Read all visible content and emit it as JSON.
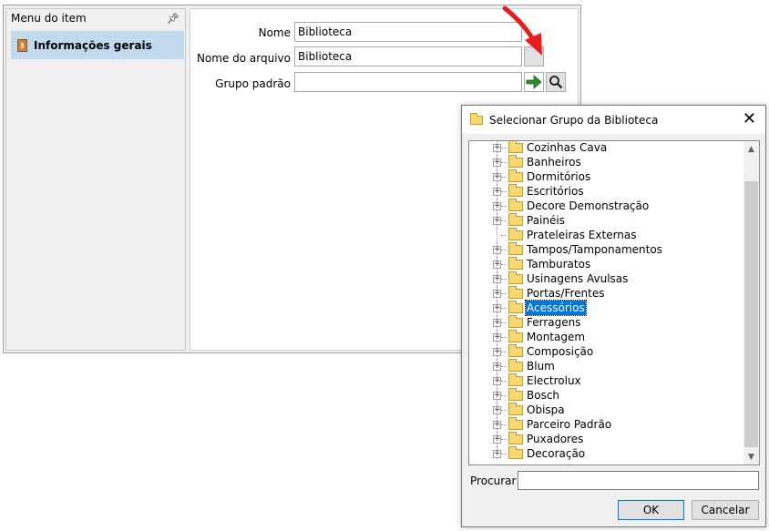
{
  "main_window": {
    "left_panel": {
      "header": "Menu do item",
      "pin_icon": "pin-icon",
      "items": [
        {
          "label": "Informações gerais",
          "icon": "info-icon"
        }
      ]
    },
    "form": {
      "name_label": "Nome",
      "name_value": "Biblioteca",
      "file_label": "Nome do arquivo",
      "file_value": "Biblioteca",
      "group_label": "Grupo padrão",
      "group_value": ""
    }
  },
  "dialog": {
    "title": "Selecionar Grupo da Biblioteca",
    "tree": [
      {
        "label": "Cozinhas Cava",
        "expandable": true
      },
      {
        "label": "Banheiros",
        "expandable": true
      },
      {
        "label": "Dormitórios",
        "expandable": true
      },
      {
        "label": "Escritórios",
        "expandable": true
      },
      {
        "label": "Decore Demonstração",
        "expandable": true
      },
      {
        "label": "Painéis",
        "expandable": true
      },
      {
        "label": "Prateleiras Externas",
        "expandable": false
      },
      {
        "label": "Tampos/Tamponamentos",
        "expandable": true
      },
      {
        "label": "Tamburatos",
        "expandable": true
      },
      {
        "label": "Usinagens Avulsas",
        "expandable": true
      },
      {
        "label": "Portas/Frentes",
        "expandable": true
      },
      {
        "label": "Acessórios",
        "expandable": true,
        "selected": true
      },
      {
        "label": "Ferragens",
        "expandable": true
      },
      {
        "label": "Montagem",
        "expandable": true
      },
      {
        "label": "Composição",
        "expandable": true
      },
      {
        "label": "Blum",
        "expandable": true
      },
      {
        "label": "Electrolux",
        "expandable": true
      },
      {
        "label": "Bosch",
        "expandable": true
      },
      {
        "label": "Obispa",
        "expandable": true
      },
      {
        "label": "Parceiro Padrão",
        "expandable": true
      },
      {
        "label": "Puxadores",
        "expandable": true
      },
      {
        "label": "Decoração",
        "expandable": true
      }
    ],
    "search_label": "Procurar",
    "search_value": "",
    "ok_label": "OK",
    "cancel_label": "Cancelar"
  },
  "colors": {
    "selection": "#0078d7",
    "accent_arrow": "#e81e1e",
    "go_arrow": "#2e8b2e"
  }
}
